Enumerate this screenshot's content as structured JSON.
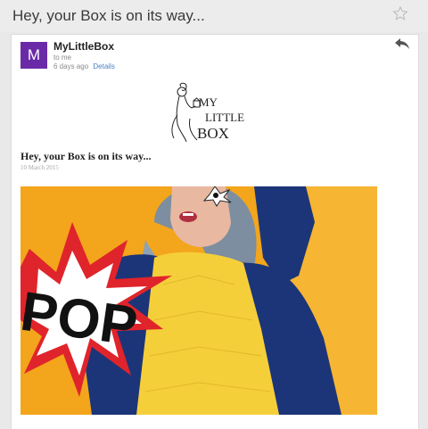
{
  "header": {
    "subject": "Hey, your Box is on its way...",
    "star_icon": "star-outline-icon"
  },
  "message": {
    "avatar_letter": "M",
    "avatar_color": "#6a2aa8",
    "sender": "MyLittleBox",
    "recipient": "to me",
    "time": "6 days ago",
    "details_link": "Details",
    "reply_icon": "reply-arrow-icon"
  },
  "email_body": {
    "logo_text": [
      "MY",
      "LITTLE",
      "BOX"
    ],
    "headline": "Hey, your Box is on its way...",
    "date": "10 March 2015",
    "hero_text": "POP",
    "hero_colors": {
      "background": "#f3a51c",
      "burst_red": "#e0242b",
      "jacket": "#1c3578",
      "sweater": "#f5cf3a"
    }
  }
}
